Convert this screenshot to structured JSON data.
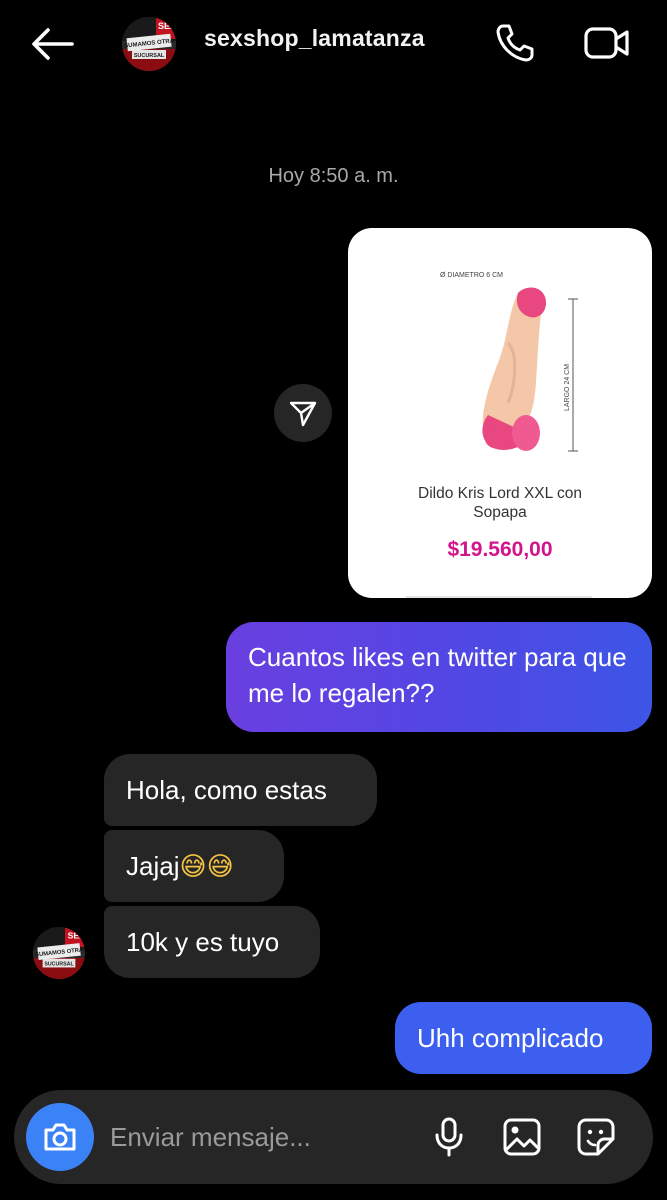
{
  "header": {
    "username": "sexshop_lamatanza",
    "back_icon": "arrow-left-icon",
    "call_icon": "phone-icon",
    "video_icon": "video-camera-icon"
  },
  "avatar_sign": {
    "line1": "SEX",
    "line2": "SUMAMOS OTRA",
    "line3": "SUCURSAL"
  },
  "timestamp": "Hoy 8:50 a. m.",
  "shared_post": {
    "diameter_label": "Ø DIAMETRO 6 CM",
    "length_label": "LARGO 24 CM",
    "product_name": "Dildo Kris Lord XXL con Sopapa",
    "price": "$19.560,00",
    "price_color": "#d4148a"
  },
  "messages": {
    "sent_1": "Cuantos likes en twitter para que me lo regalen??",
    "received_1": "Hola, como estas",
    "received_2_text": "Jajaj",
    "received_2_emoji": "😅😅",
    "received_3": "10k y es tuyo",
    "sent_2": "Uhh complicado"
  },
  "composer": {
    "placeholder": "Enviar mensaje..."
  },
  "colors": {
    "background": "#000000",
    "received_bubble": "#262626",
    "sent_gradient_start": "#6a3fe0",
    "sent_gradient_end": "#3d55e6",
    "sent_blue": "#3c5ff0",
    "camera_button": "#3b82f6"
  }
}
